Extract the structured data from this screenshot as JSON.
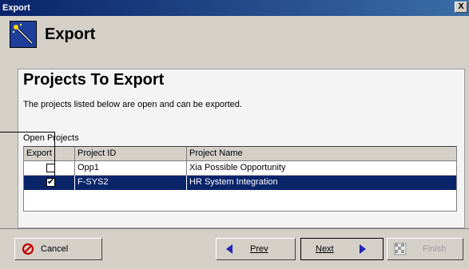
{
  "window": {
    "title": "Export",
    "close_label": "X"
  },
  "header": {
    "title": "Export",
    "icon": "wand-icon"
  },
  "panel": {
    "heading": "Projects To Export",
    "description": "The projects listed below are open and can be exported.",
    "section_label": "Open Projects"
  },
  "grid": {
    "columns": [
      "Export",
      "Project ID",
      "Project Name"
    ],
    "rows": [
      {
        "export": false,
        "project_id": "Opp1",
        "project_name": "Xia Possible Opportunity",
        "selected": false
      },
      {
        "export": true,
        "project_id": "F-SYS2",
        "project_name": "HR System Integration",
        "selected": true
      }
    ]
  },
  "buttons": {
    "cancel": "Cancel",
    "prev": "Prev",
    "next": "Next",
    "finish": "Finish"
  },
  "colors": {
    "title_bar": "#0a246a",
    "selection": "#0a246a",
    "cancel_icon": "#c00000",
    "arrow": "#2323b4"
  }
}
